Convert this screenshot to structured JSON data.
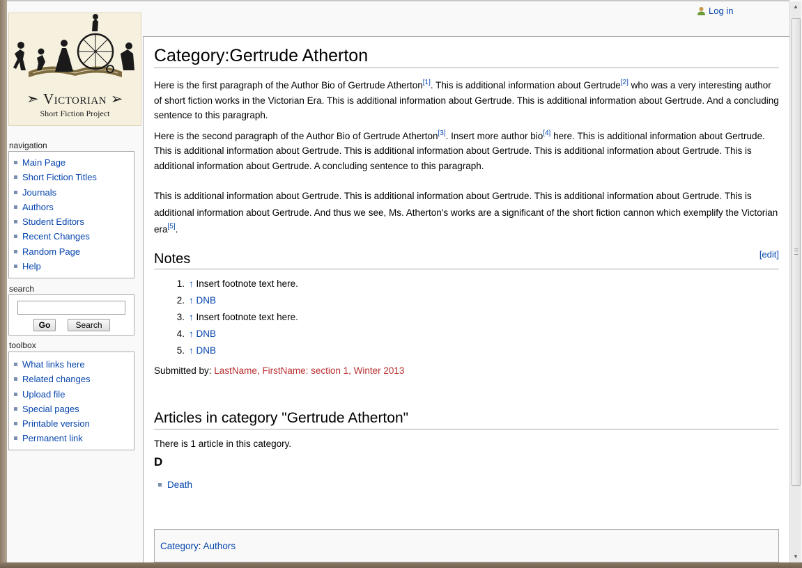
{
  "user_menu": {
    "login_label": "Log in"
  },
  "logo": {
    "title": "Victorian",
    "subtitle": "Short Fiction Project"
  },
  "navigation": {
    "heading": "navigation",
    "items": [
      "Main Page",
      "Short Fiction Titles",
      "Journals",
      "Authors",
      "Student Editors",
      "Recent Changes",
      "Random Page",
      "Help"
    ]
  },
  "search": {
    "heading": "search",
    "go_label": "Go",
    "search_label": "Search",
    "input_value": ""
  },
  "toolbox": {
    "heading": "toolbox",
    "items": [
      "What links here",
      "Related changes",
      "Upload file",
      "Special pages",
      "Printable version",
      "Permanent link"
    ]
  },
  "page": {
    "title": "Category:Gertrude Atherton",
    "para1": {
      "a": "Here is the first paragraph of the Author Bio of Gertrude Atherton",
      "ref1": "[1]",
      "b": ". This is additional information about Gertrude",
      "ref2": "[2]",
      "c": " who was a very interesting author of short fiction works in the Victorian Era. This is additional information about Gertrude. This is additional information about Gertrude. And a concluding sentence to this paragraph."
    },
    "para2": {
      "a": "Here is the second paragraph of the Author Bio of Gertrude Atherton",
      "ref3": "[3]",
      "b": ". Insert more author bio",
      "ref4": "[4]",
      "c": " here. This is additional information about Gertrude. This is additional information about Gertrude. This is additional information about Gertrude. This is additional information about Gertrude. This is additional information about Gertrude. A concluding sentence to this paragraph."
    },
    "para3": {
      "a": "This is additional information about Gertrude. This is additional information about Gertrude. This is additional information about Gertrude. This is additional information about Gertrude. And thus we see, Ms. Atherton's works are a significant of the short fiction cannon which exemplify the Victorian era",
      "ref5": "[5]",
      "b": "."
    },
    "notes_heading": "Notes",
    "edit_label": "[edit]",
    "notes": [
      {
        "num": "1.",
        "arrow": "↑",
        "text": "Insert footnote text here.",
        "is_link": false
      },
      {
        "num": "2.",
        "arrow": "↑",
        "text": "DNB",
        "is_link": true
      },
      {
        "num": "3.",
        "arrow": "↑",
        "text": "Insert footnote text here.",
        "is_link": false
      },
      {
        "num": "4.",
        "arrow": "↑",
        "text": "DNB",
        "is_link": true
      },
      {
        "num": "5.",
        "arrow": "↑",
        "text": "DNB",
        "is_link": true
      }
    ],
    "submitted_prefix": "Submitted by: ",
    "submitted_link": "LastName, FirstName: section 1, Winter 2013",
    "category_heading": "Articles in category \"Gertrude Atherton\"",
    "category_count": "There is 1 article in this category.",
    "letter_heading": "D",
    "articles": [
      "Death"
    ],
    "catlinks_prefix": "Category",
    "catlinks_sep": ": ",
    "catlinks_item": "Authors"
  },
  "colors": {
    "link": "#0645ad",
    "new_link": "#ba2f2f",
    "border": "#aaaaaa"
  }
}
